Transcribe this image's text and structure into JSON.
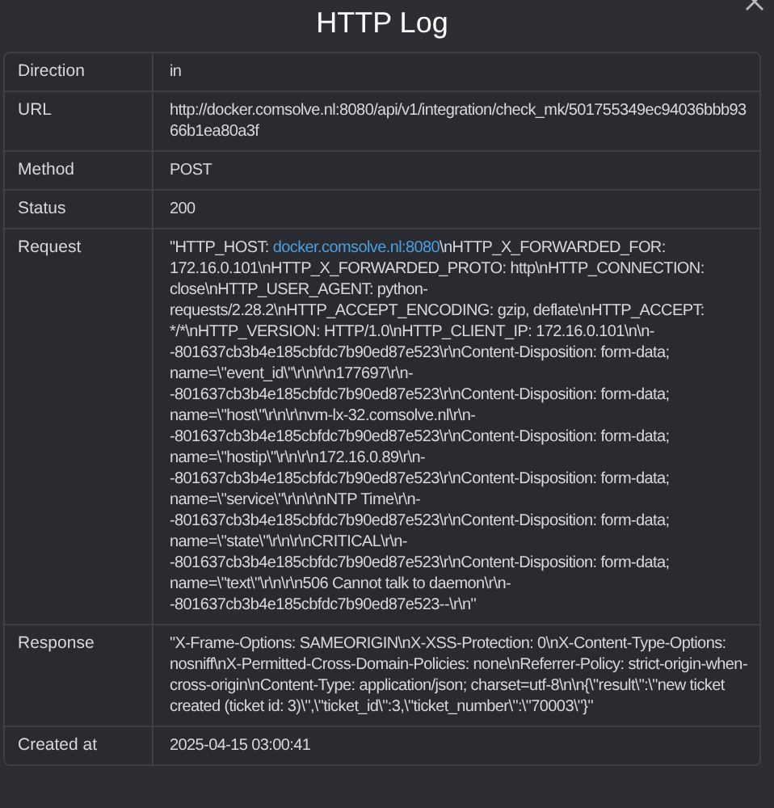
{
  "dialog": {
    "title": "HTTP Log"
  },
  "rows": [
    {
      "label": "Direction",
      "kind": "text",
      "value": "in"
    },
    {
      "label": "URL",
      "kind": "text",
      "value": "http://docker.comsolve.nl:8080/api/v1/integration/check_mk/501755349ec94036bbb9366b1ea80a3f"
    },
    {
      "label": "Method",
      "kind": "text",
      "value": "POST"
    },
    {
      "label": "Status",
      "kind": "text",
      "value": "200"
    },
    {
      "label": "Request",
      "kind": "linked",
      "before": "\"HTTP_HOST: ",
      "link": "docker.comsolve.nl:8080",
      "after": "\\nHTTP_X_FORWARDED_FOR: 172.16.0.101\\nHTTP_X_FORWARDED_PROTO: http\\nHTTP_CONNECTION: close\\nHTTP_USER_AGENT: python-requests/2.28.2\\nHTTP_ACCEPT_ENCODING: gzip, deflate\\nHTTP_ACCEPT: */*\\nHTTP_VERSION: HTTP/1.0\\nHTTP_CLIENT_IP: 172.16.0.101\\n\\n--801637cb3b4e185cbfdc7b90ed87e523\\r\\nContent-Disposition: form-data; name=\\\"event_id\\\"\\r\\n\\r\\n177697\\r\\n--801637cb3b4e185cbfdc7b90ed87e523\\r\\nContent-Disposition: form-data; name=\\\"host\\\"\\r\\n\\r\\nvm-lx-32.comsolve.nl\\r\\n--801637cb3b4e185cbfdc7b90ed87e523\\r\\nContent-Disposition: form-data; name=\\\"hostip\\\"\\r\\n\\r\\n172.16.0.89\\r\\n--801637cb3b4e185cbfdc7b90ed87e523\\r\\nContent-Disposition: form-data; name=\\\"service\\\"\\r\\n\\r\\nNTP Time\\r\\n--801637cb3b4e185cbfdc7b90ed87e523\\r\\nContent-Disposition: form-data; name=\\\"state\\\"\\r\\n\\r\\nCRITICAL\\r\\n--801637cb3b4e185cbfdc7b90ed87e523\\r\\nContent-Disposition: form-data; name=\\\"text\\\"\\r\\n\\r\\n506 Cannot talk to daemon\\r\\n--801637cb3b4e185cbfdc7b90ed87e523--\\r\\n\""
    },
    {
      "label": "Response",
      "kind": "text",
      "value": "\"X-Frame-Options: SAMEORIGIN\\nX-XSS-Protection: 0\\nX-Content-Type-Options: nosniff\\nX-Permitted-Cross-Domain-Policies: none\\nReferrer-Policy: strict-origin-when-cross-origin\\nContent-Type: application/json; charset=utf-8\\n\\n{\\\"result\\\":\\\"new ticket created (ticket id: 3)\\\",\\\"ticket_id\\\":3,\\\"ticket_number\\\":\\\"70003\\\"}\""
    },
    {
      "label": "Created at",
      "kind": "text",
      "value": "2025-04-15 03:00:41"
    }
  ]
}
